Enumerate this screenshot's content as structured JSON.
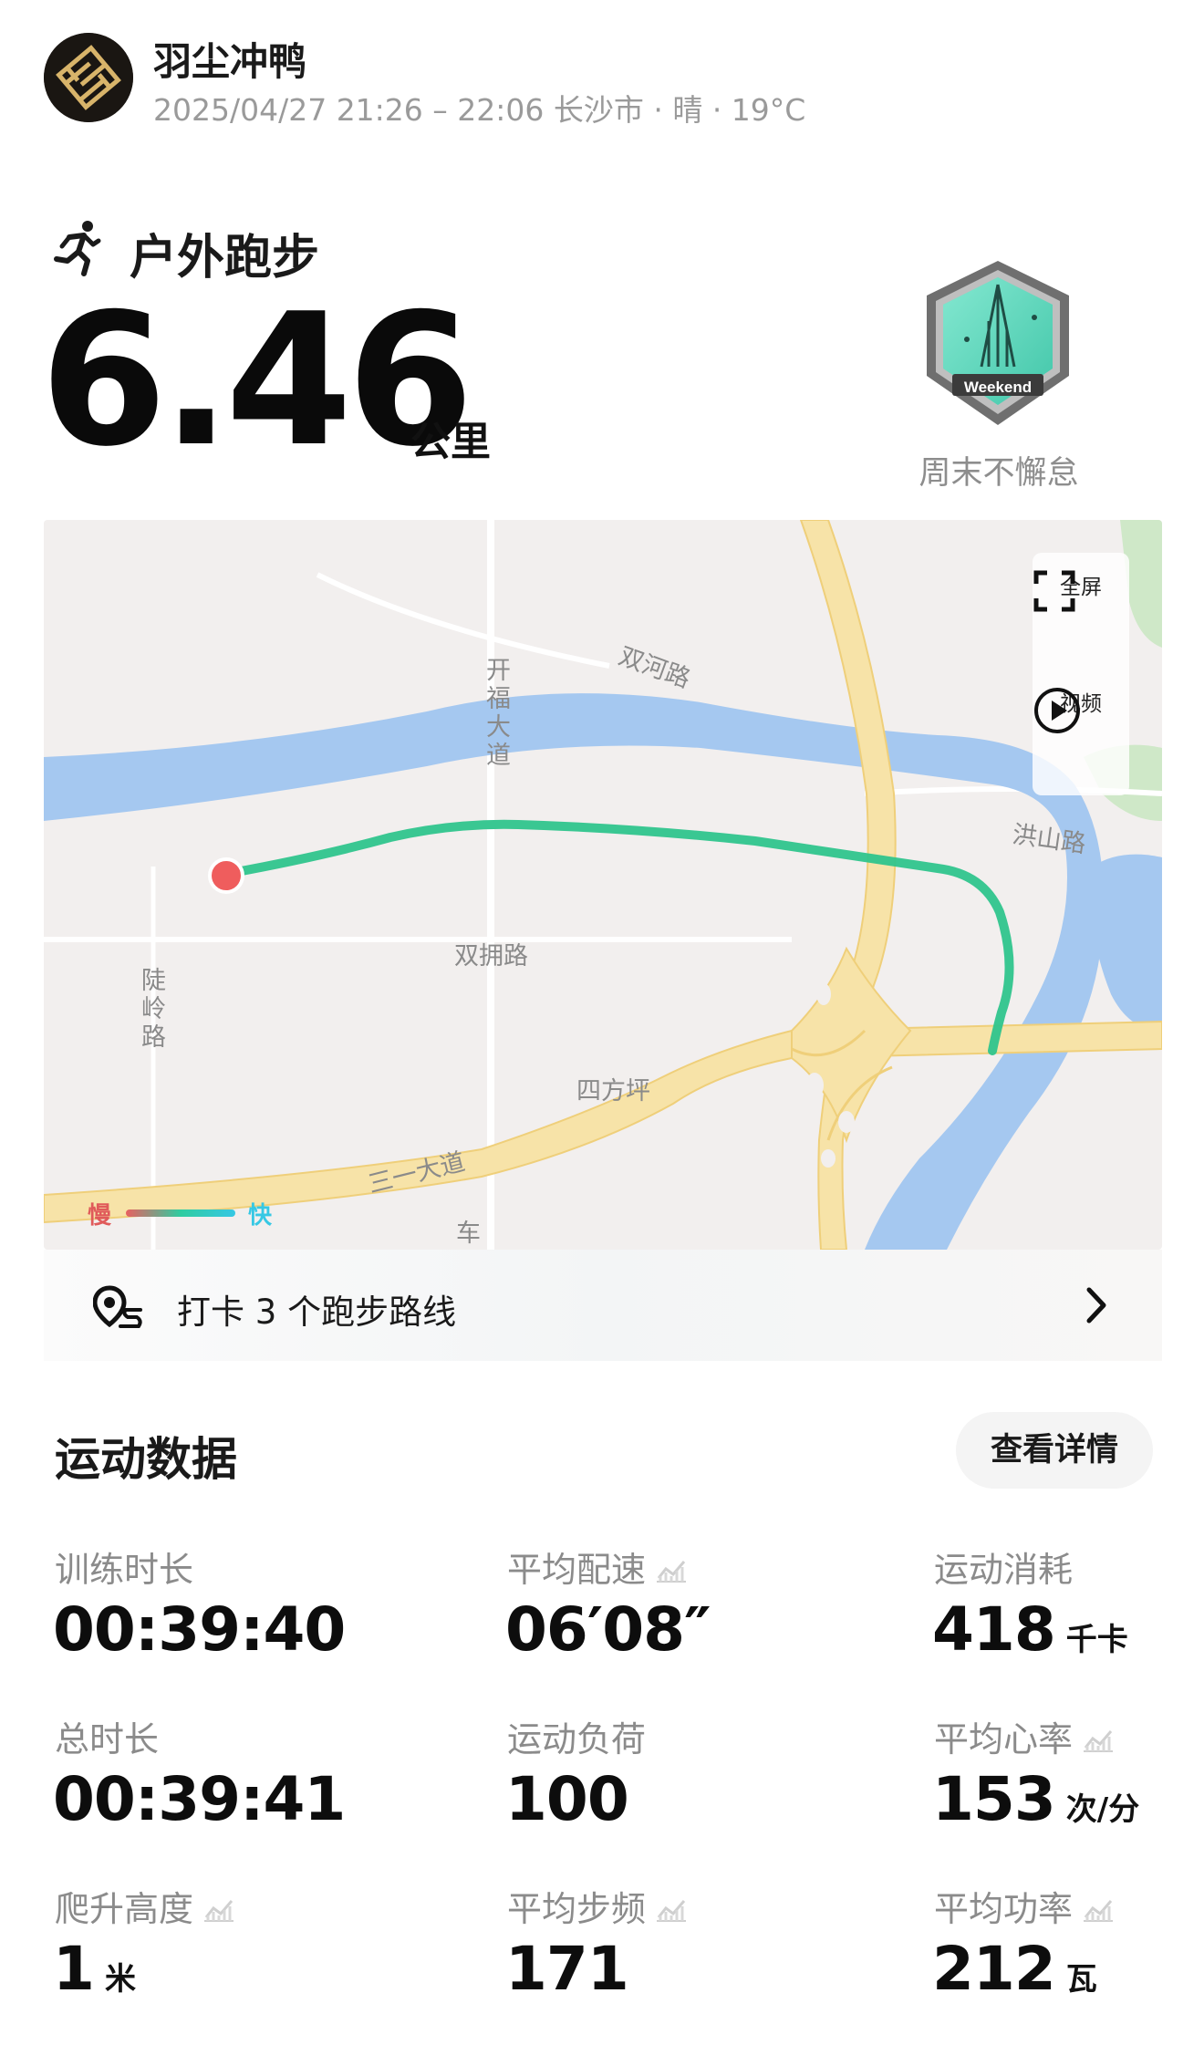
{
  "header": {
    "username": "羽尘冲鸭",
    "meta": "2025/04/27 21:26 – 22:06 长沙市 · 晴 · 19°C"
  },
  "activity": {
    "type_label": "户外跑步",
    "distance": "6.46",
    "distance_unit": "公里",
    "badge_text": "Weekend",
    "badge_label": "周末不懈怠"
  },
  "map": {
    "labels": {
      "kaifu": "开福大道",
      "shuanghe": "双河路",
      "hongshan": "洪山路",
      "shuangyong": "双拥路",
      "luling": "陡岭路",
      "sifangping": "四方坪",
      "sanyi": "三一大道",
      "che": "车"
    },
    "fullscreen_label": "全屏",
    "video_label": "视频",
    "legend_slow": "慢",
    "legend_fast": "快",
    "colors": {
      "water": "#a5c8f0",
      "road": "#f7e3a8",
      "route": "#2fc48c",
      "start": "#ef5d5d"
    }
  },
  "checkin": {
    "text": "打卡 3 个跑步路线"
  },
  "stats": {
    "title": "运动数据",
    "detail_button": "查看详情",
    "items": [
      {
        "label": "训练时长",
        "value": "00:39:40",
        "unit": ""
      },
      {
        "label": "平均配速",
        "value": "06′08″",
        "unit": "",
        "icon": "chart-icon"
      },
      {
        "label": "运动消耗",
        "value": "418",
        "unit": "千卡"
      },
      {
        "label": "总时长",
        "value": "00:39:41",
        "unit": ""
      },
      {
        "label": "运动负荷",
        "value": "100",
        "unit": ""
      },
      {
        "label": "平均心率",
        "value": "153",
        "unit": "次/分",
        "icon": "chart-icon"
      },
      {
        "label": "爬升高度",
        "value": "1",
        "unit": "米",
        "icon": "chart-icon"
      },
      {
        "label": "平均步频",
        "value": "171",
        "unit": "",
        "icon": "chart-icon"
      },
      {
        "label": "平均功率",
        "value": "212",
        "unit": "瓦",
        "icon": "chart-icon"
      }
    ]
  }
}
